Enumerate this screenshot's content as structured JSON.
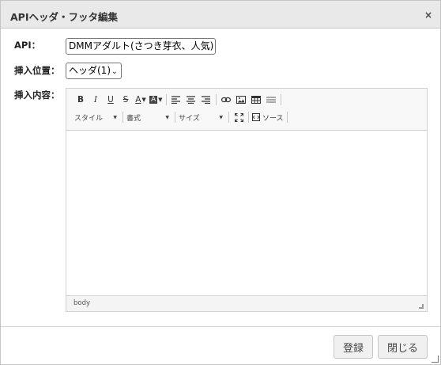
{
  "dialog": {
    "title": "APIヘッダ・フッタ編集",
    "close_glyph": "×"
  },
  "form": {
    "api_label": "API：",
    "api_value": "DMMアダルト(さつき芽衣、人気)",
    "position_label": "挿入位置：",
    "position_value": "ヘッダ(1)",
    "content_label": "挿入内容："
  },
  "editor": {
    "toolbar": {
      "bold": "B",
      "italic": "I",
      "underline": "U",
      "strike": "S",
      "text_color": "A",
      "bg_color": "A",
      "style_combo": "スタイル",
      "format_combo": "書式",
      "size_combo": "サイズ",
      "source": "ソース"
    },
    "status_path": "body"
  },
  "buttons": {
    "register": "登録",
    "close": "閉じる"
  }
}
